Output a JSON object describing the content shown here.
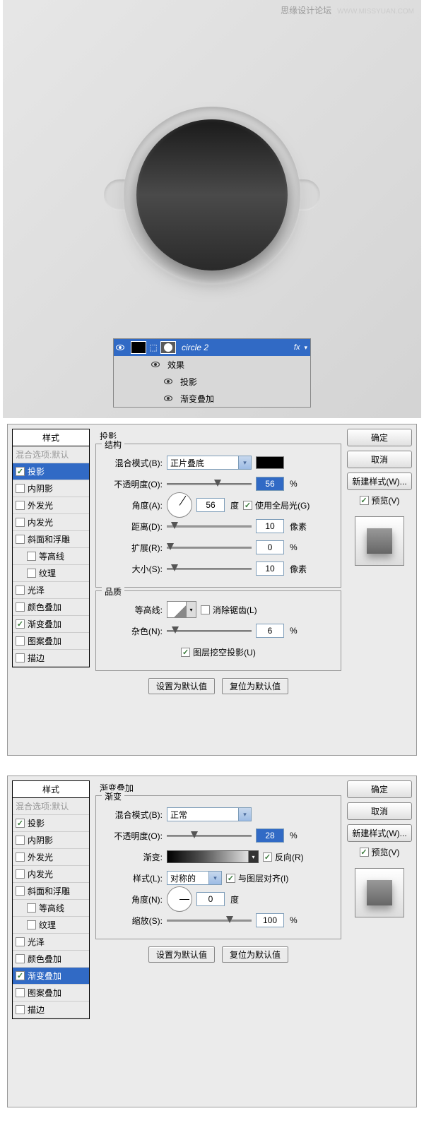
{
  "watermark": {
    "text1": "思缘设计论坛",
    "text2": "WWW.MISSYUAN.COM"
  },
  "layers": {
    "main_label": "circle 2",
    "fx_indicator": "fx",
    "effects_label": "效果",
    "drop_shadow_label": "投影",
    "grad_overlay_label": "渐变叠加"
  },
  "dialog1": {
    "styles_title": "样式",
    "blend_options": "混合选项:默认",
    "styles": [
      "投影",
      "内阴影",
      "外发光",
      "内发光",
      "斜面和浮雕",
      "等高线",
      "纹理",
      "光泽",
      "颜色叠加",
      "渐变叠加",
      "图案叠加",
      "描边"
    ],
    "checked_styles": [
      "投影",
      "渐变叠加"
    ],
    "selected_style": "投影",
    "group_main": "投影",
    "group_structure": "结构",
    "blend_mode_label": "混合模式(B):",
    "blend_mode_value": "正片叠底",
    "opacity_label": "不透明度(O):",
    "opacity_value": "56",
    "opacity_unit": "%",
    "angle_label": "角度(A):",
    "angle_value": "56",
    "angle_unit": "度",
    "use_global_light": "使用全局光(G)",
    "distance_label": "距离(D):",
    "distance_value": "10",
    "distance_unit": "像素",
    "spread_label": "扩展(R):",
    "spread_value": "0",
    "spread_unit": "%",
    "size_label": "大小(S):",
    "size_value": "10",
    "size_unit": "像素",
    "group_quality": "品质",
    "contour_label": "等高线:",
    "antialias_label": "消除锯齿(L)",
    "noise_label": "杂色(N):",
    "noise_value": "6",
    "noise_unit": "%",
    "knockout_label": "图层挖空投影(U)",
    "set_default": "设置为默认值",
    "reset_default": "复位为默认值",
    "ok": "确定",
    "cancel": "取消",
    "new_style": "新建样式(W)...",
    "preview_label": "预览(V)"
  },
  "dialog2": {
    "selected_style": "渐变叠加",
    "group_main": "渐变叠加",
    "group_sub": "渐变",
    "blend_mode_label": "混合模式(B):",
    "blend_mode_value": "正常",
    "opacity_label": "不透明度(O):",
    "opacity_value": "28",
    "opacity_unit": "%",
    "gradient_label": "渐变:",
    "reverse_label": "反向(R)",
    "style_label": "样式(L):",
    "style_value": "对称的",
    "align_label": "与图层对齐(I)",
    "angle_label": "角度(N):",
    "angle_value": "0",
    "angle_unit": "度",
    "scale_label": "缩放(S):",
    "scale_value": "100",
    "scale_unit": "%",
    "set_default": "设置为默认值",
    "reset_default": "复位为默认值",
    "ok": "确定",
    "cancel": "取消",
    "new_style": "新建样式(W)...",
    "preview_label": "预览(V)"
  }
}
